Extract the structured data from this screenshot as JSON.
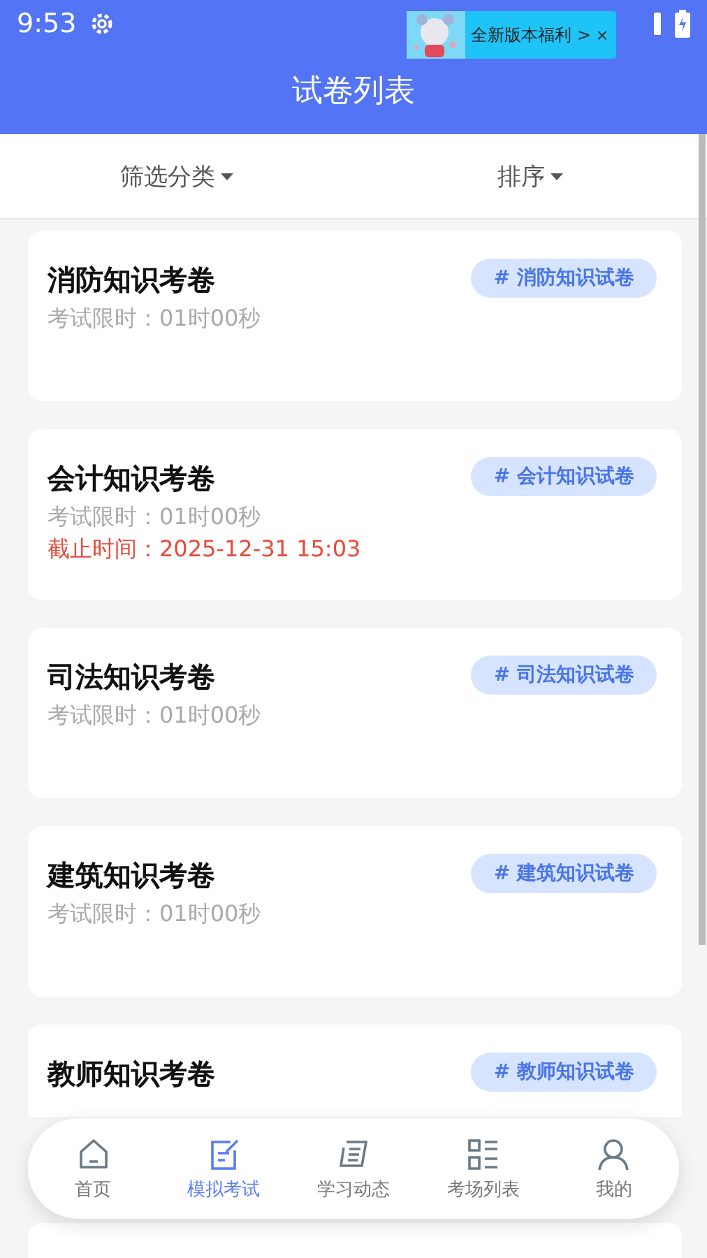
{
  "status_bar": {
    "time": "9:53"
  },
  "promo_banner": {
    "text": "全新版本福利",
    "arrow": ">",
    "close": "×"
  },
  "header": {
    "title": "试卷列表"
  },
  "filters": [
    {
      "label": "筛选分类"
    },
    {
      "label": "排序"
    }
  ],
  "papers": [
    {
      "title": "消防知识考卷",
      "time_limit": "考试限时：01时00秒",
      "tag": "# 消防知识试卷"
    },
    {
      "title": "会计知识考卷",
      "time_limit": "考试限时：01时00秒",
      "deadline": "截止时间：2025-12-31 15:03",
      "tag": "# 会计知识试卷"
    },
    {
      "title": "司法知识考卷",
      "time_limit": "考试限时：01时00秒",
      "tag": "# 司法知识试卷"
    },
    {
      "title": "建筑知识考卷",
      "time_limit": "考试限时：01时00秒",
      "tag": "# 建筑知识试卷"
    },
    {
      "title": "教师知识考卷",
      "tag": "# 教师知识试卷"
    }
  ],
  "bottom_nav": [
    {
      "kind": "home",
      "label": "首页",
      "selected": false
    },
    {
      "kind": "exam",
      "label": "模拟考试",
      "selected": true
    },
    {
      "kind": "news",
      "label": "学习动态",
      "selected": false
    },
    {
      "kind": "list",
      "label": "考场列表",
      "selected": false
    },
    {
      "kind": "profile",
      "label": "我的",
      "selected": false
    }
  ]
}
